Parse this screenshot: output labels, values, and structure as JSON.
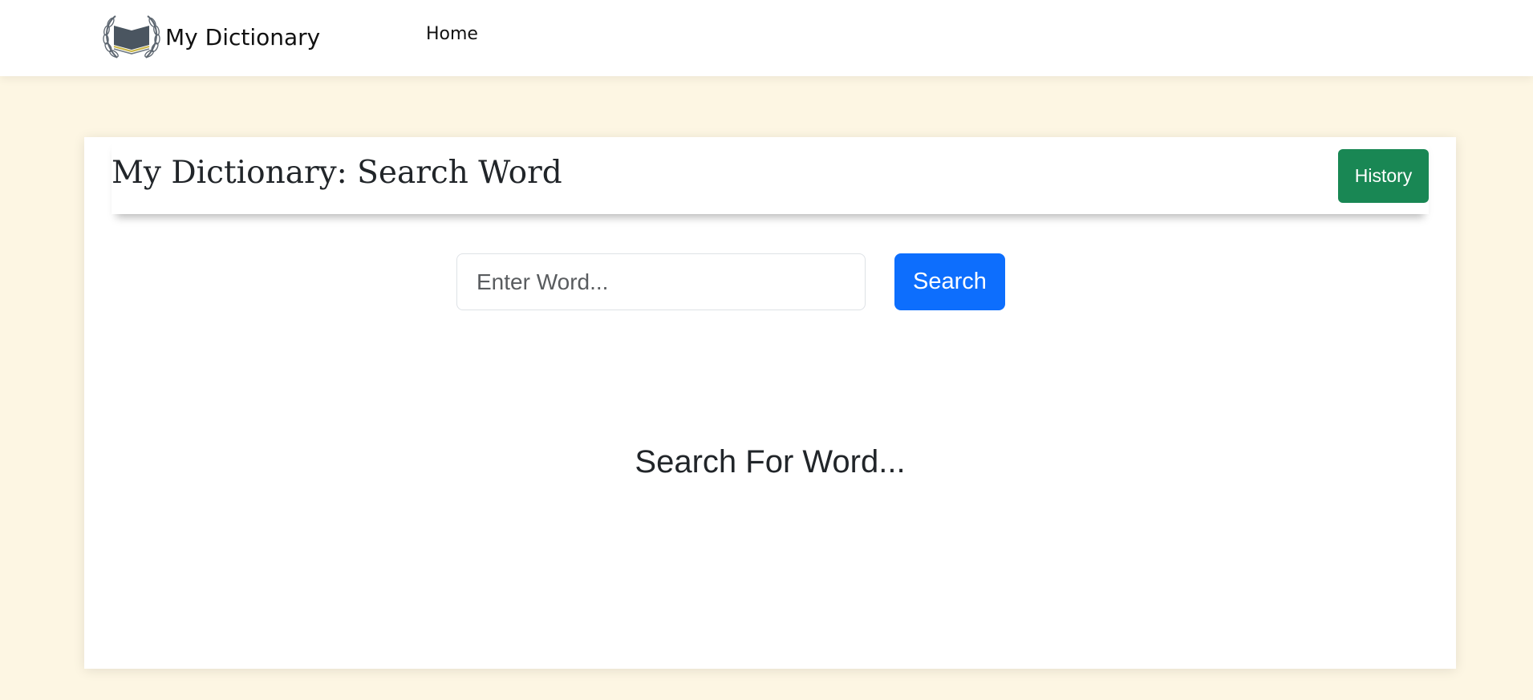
{
  "navbar": {
    "brand_name": "My Dictionary",
    "brand_icon": "open-book-laurel-icon",
    "links": [
      {
        "label": "Home"
      }
    ]
  },
  "card": {
    "title": "My Dictionary: Search Word",
    "history_label": "History"
  },
  "search": {
    "placeholder": "Enter Word...",
    "value": "",
    "button_label": "Search"
  },
  "result": {
    "message": "Search For Word..."
  },
  "colors": {
    "page_background": "#fdf6e3",
    "history_button": "#198754",
    "search_button": "#0d6efd",
    "logo_book": "#4a5560",
    "logo_pages_accent": "#c9b545"
  }
}
